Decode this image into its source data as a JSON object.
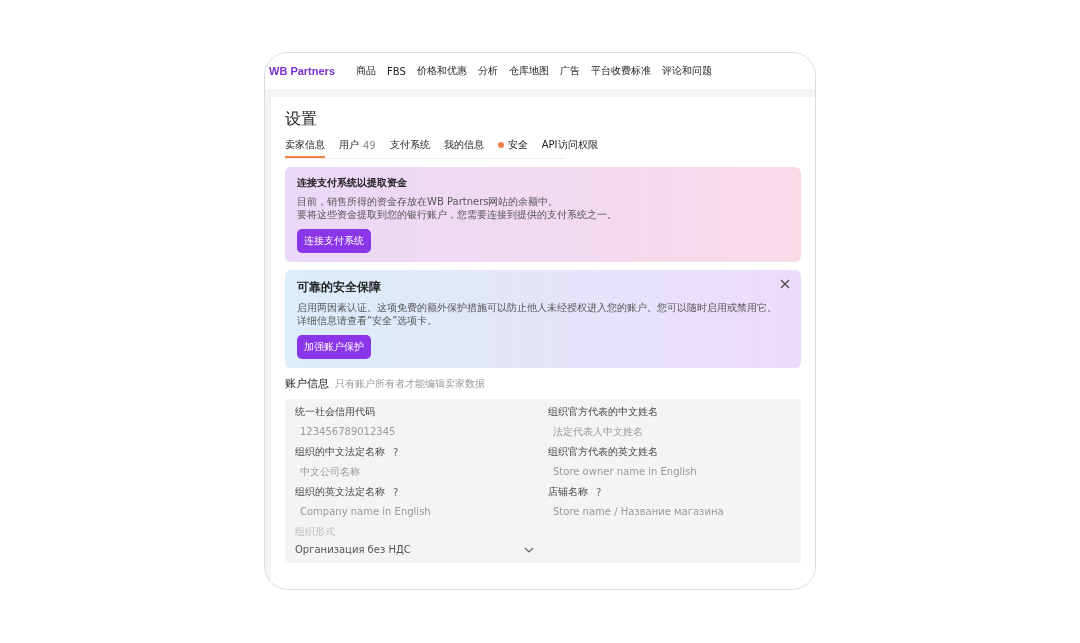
{
  "brand": "WB Partners",
  "nav": [
    "商品",
    "FBS",
    "价格和优惠",
    "分析",
    "仓库地图",
    "广告",
    "平台收费标准",
    "评论和问题"
  ],
  "page_title": "设置",
  "tabs": [
    {
      "label": "卖家信息",
      "selected": true,
      "alert": false
    },
    {
      "label": "用户",
      "count": "49",
      "selected": false,
      "alert": false
    },
    {
      "label": "支付系统",
      "selected": false,
      "alert": false
    },
    {
      "label": "我的信息",
      "selected": false,
      "alert": false
    },
    {
      "label": "安全",
      "selected": false,
      "alert": true
    },
    {
      "label": "API访问权限",
      "selected": false,
      "alert": false
    }
  ],
  "banners": [
    {
      "kind": "payment",
      "title": "连接支付系统以提取资金",
      "lines": [
        "目前，销售所得的资金存放在WB Partners网站的余额中。",
        "要将这些资金提取到您的银行账户，您需要连接到提供的支付系统之一。"
      ],
      "button": "连接支付系统",
      "closable": false
    },
    {
      "kind": "security",
      "title": "可靠的安全保障",
      "lines": [
        "启用两因素认证。这项免费的额外保护措施可以防止他人未经授权进入您的账户。您可以随时启用或禁用它。",
        "详细信息请查看“安全”选项卡。"
      ],
      "button": "加强账户保护",
      "closable": true
    }
  ],
  "account": {
    "title": "账户信息",
    "hint": "只有账户所有者才能编辑卖家数据",
    "fields": [
      {
        "kind": "text",
        "label": "统一社会信用代码",
        "placeholder": "123456789012345",
        "disabled": false
      },
      {
        "kind": "text",
        "label": "组织官方代表的中文姓名",
        "placeholder": "法定代表人中文姓名",
        "disabled": false
      },
      {
        "kind": "text",
        "label": "组织的中文法定名称",
        "placeholder": "中文公司名称",
        "help_mark": "?",
        "disabled": false
      },
      {
        "kind": "text",
        "label": "组织官方代表的英文姓名",
        "placeholder": "Store owner name in English",
        "disabled": false
      },
      {
        "kind": "text",
        "label": "组织的英文法定名称",
        "placeholder": "Company name in English",
        "help_mark": "?",
        "disabled": false
      },
      {
        "kind": "text",
        "label": "店铺名称",
        "placeholder": "Store name / Название магазина",
        "help_mark": "?",
        "disabled": false
      },
      {
        "kind": "select",
        "label": "组织形式",
        "value": "Организация без НДС",
        "disabled": true
      }
    ]
  }
}
